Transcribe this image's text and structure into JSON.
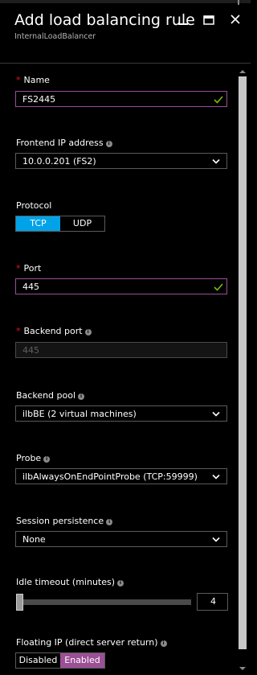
{
  "header": {
    "title": "Add load balancing rule",
    "subtitle": "InternalLoadBalancer",
    "minimize_icon": "minimize-icon",
    "maximize_icon": "maximize-icon",
    "close_icon": "close-icon"
  },
  "form": {
    "name": {
      "label": "Name",
      "required": true,
      "value": "FS2445",
      "valid": true
    },
    "frontend_ip": {
      "label": "Frontend IP address",
      "value": "10.0.0.201 (FS2)"
    },
    "protocol": {
      "label": "Protocol",
      "options": [
        "TCP",
        "UDP"
      ],
      "selected": "TCP"
    },
    "port": {
      "label": "Port",
      "required": true,
      "value": "445",
      "valid": true
    },
    "backend_port": {
      "label": "Backend port",
      "required": true,
      "value": "445",
      "disabled": true
    },
    "backend_pool": {
      "label": "Backend pool",
      "value": "ilbBE (2 virtual machines)"
    },
    "probe": {
      "label": "Probe",
      "value": "ilbAlwaysOnEndPointProbe (TCP:59999)"
    },
    "session_persistence": {
      "label": "Session persistence",
      "value": "None"
    },
    "idle_timeout": {
      "label": "Idle timeout (minutes)",
      "value": "4",
      "slider_fraction": 0.0
    },
    "floating_ip": {
      "label": "Floating IP (direct server return)",
      "options": [
        "Disabled",
        "Enabled"
      ],
      "selected": "Enabled"
    }
  },
  "colors": {
    "accent_blue": "#00a2e8",
    "accent_purple": "#9b4f96",
    "required_red": "#e81123",
    "valid_green": "#7fba00"
  }
}
